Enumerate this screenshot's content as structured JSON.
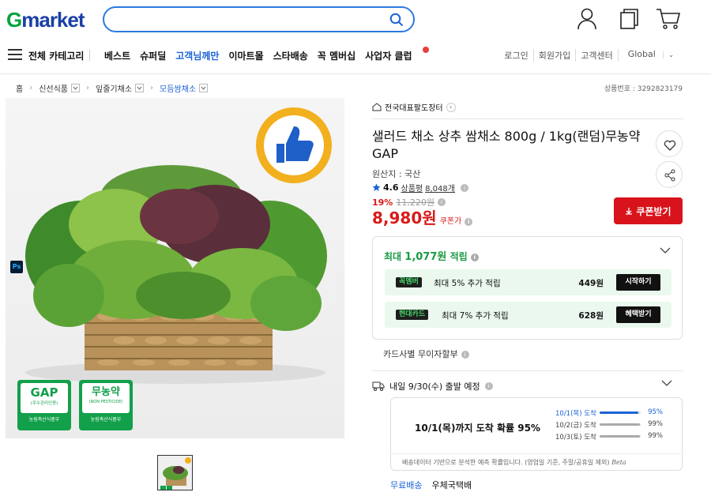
{
  "header": {
    "logo_g": "G",
    "logo_rest": "market",
    "search_placeholder": ""
  },
  "nav": {
    "all_categories": "전체 카테고리",
    "links": [
      "베스트",
      "슈퍼딜",
      "고객님께만",
      "이마트몰",
      "스타배송",
      "꼭 멤버십",
      "사업자 클럽"
    ],
    "util": [
      "로그인",
      "회원가입",
      "고객센터",
      "Global"
    ]
  },
  "breadcrumb": [
    "홈",
    "신선식품",
    "잎줄기채소",
    "모듬쌈채소"
  ],
  "product_no": "상품번호 : 3292823179",
  "seller": "전국대표팔도장터",
  "title": "샐러드 채소 상추 쌈채소 800g / 1kg(랜덤)무농약 GAP",
  "origin": "원산지 : 국산",
  "rating": {
    "score": "4.6",
    "label": "상품평",
    "count": "8,048개"
  },
  "price": {
    "discount": "19%",
    "original": "11,220원",
    "final": "8,980원",
    "coupon_label": "쿠폰가",
    "coupon_button": "쿠폰받기"
  },
  "points": {
    "head_prefix": "최대",
    "head_amount": "1,077원",
    "head_suffix": "적립",
    "rows": [
      {
        "tag": "꼭멤버",
        "text": "최대 5% 추가 적립",
        "amount": "449원",
        "button": "시작하기"
      },
      {
        "tag": "현대카드",
        "text": "최대 7% 추가 적립",
        "amount": "628원",
        "button": "혜택받기"
      }
    ]
  },
  "card_installment": "카드사별 무이자할부",
  "shipping": {
    "header": "내일 9/30(수) 출발 예정",
    "probability": "10/1(목)까지 도착 확률 95%",
    "rows": [
      {
        "label": "10/1(목) 도착",
        "pct": "95%",
        "value": 0.95
      },
      {
        "label": "10/2(금) 도착",
        "pct": "99%",
        "value": 0.99
      },
      {
        "label": "10/3(토) 도착",
        "pct": "99%",
        "value": 0.99
      }
    ],
    "note": "배송데이터 기반으로 분석한 예측 확률입니다. (영업일 기준, 주말/공휴일 제외)",
    "beta": "Beta",
    "free": "무료배송",
    "carrier": "우체국택배"
  },
  "badges": {
    "gap": "GAP",
    "gap_sub": "(우수관리인증)",
    "gap_foot": "농림축산식품부",
    "organic": "무농약",
    "organic_sub": "(NON PESTICIDE)",
    "organic_foot": "농림축산식품부"
  },
  "colors": {
    "brand_green": "#00a33e",
    "price_red": "#d91a1a",
    "link_blue": "#1c62d8",
    "coupon_red": "#d8131c"
  }
}
